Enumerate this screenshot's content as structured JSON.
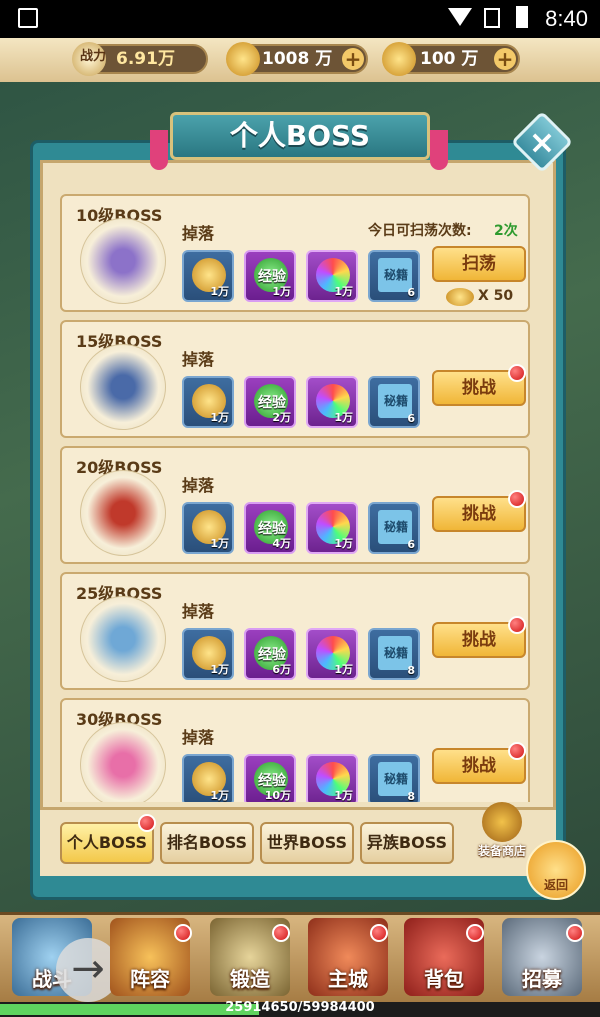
{
  "status_bar": {
    "time": "8:40"
  },
  "resources": {
    "power": {
      "label": "战力",
      "value": "6.91万"
    },
    "gold": {
      "value": "1008 万"
    },
    "ingot": {
      "value": "100 万"
    }
  },
  "panel_title": "个人BOSS",
  "scan_count": {
    "label": "今日可扫荡次数:",
    "value": "2次"
  },
  "drop_label": "掉落",
  "sweep_cost": "X 50",
  "bosses": [
    {
      "level": "10级BOSS",
      "coin": "1万",
      "exp_label": "经验",
      "exp": "1万",
      "gem": "1万",
      "book": "6",
      "book_label": "秘籍",
      "button": "扫荡"
    },
    {
      "level": "15级BOSS",
      "coin": "1万",
      "exp_label": "经验",
      "exp": "2万",
      "gem": "1万",
      "book": "6",
      "book_label": "秘籍",
      "button": "挑战"
    },
    {
      "level": "20级BOSS",
      "coin": "1万",
      "exp_label": "经验",
      "exp": "4万",
      "gem": "1万",
      "book": "6",
      "book_label": "秘籍",
      "button": "挑战"
    },
    {
      "level": "25级BOSS",
      "coin": "1万",
      "exp_label": "经验",
      "exp": "6万",
      "gem": "1万",
      "book": "8",
      "book_label": "秘籍",
      "button": "挑战"
    },
    {
      "level": "30级BOSS",
      "coin": "1万",
      "exp_label": "经验",
      "exp": "10万",
      "gem": "1万",
      "book": "8",
      "book_label": "秘籍",
      "button": "挑战"
    }
  ],
  "tabs": [
    "个人BOSS",
    "排名BOSS",
    "世界BOSS",
    "异族BOSS"
  ],
  "shop_label": "装备商店",
  "back_label": "返回",
  "nav": [
    "战斗",
    "阵容",
    "锻造",
    "主城",
    "背包",
    "招募"
  ],
  "exp_progress": "25914650/59984400",
  "exp_fraction": 0.432,
  "colors": {
    "accent": "#2f8a94",
    "button": "#f0b637",
    "reddot": "#d11414"
  }
}
